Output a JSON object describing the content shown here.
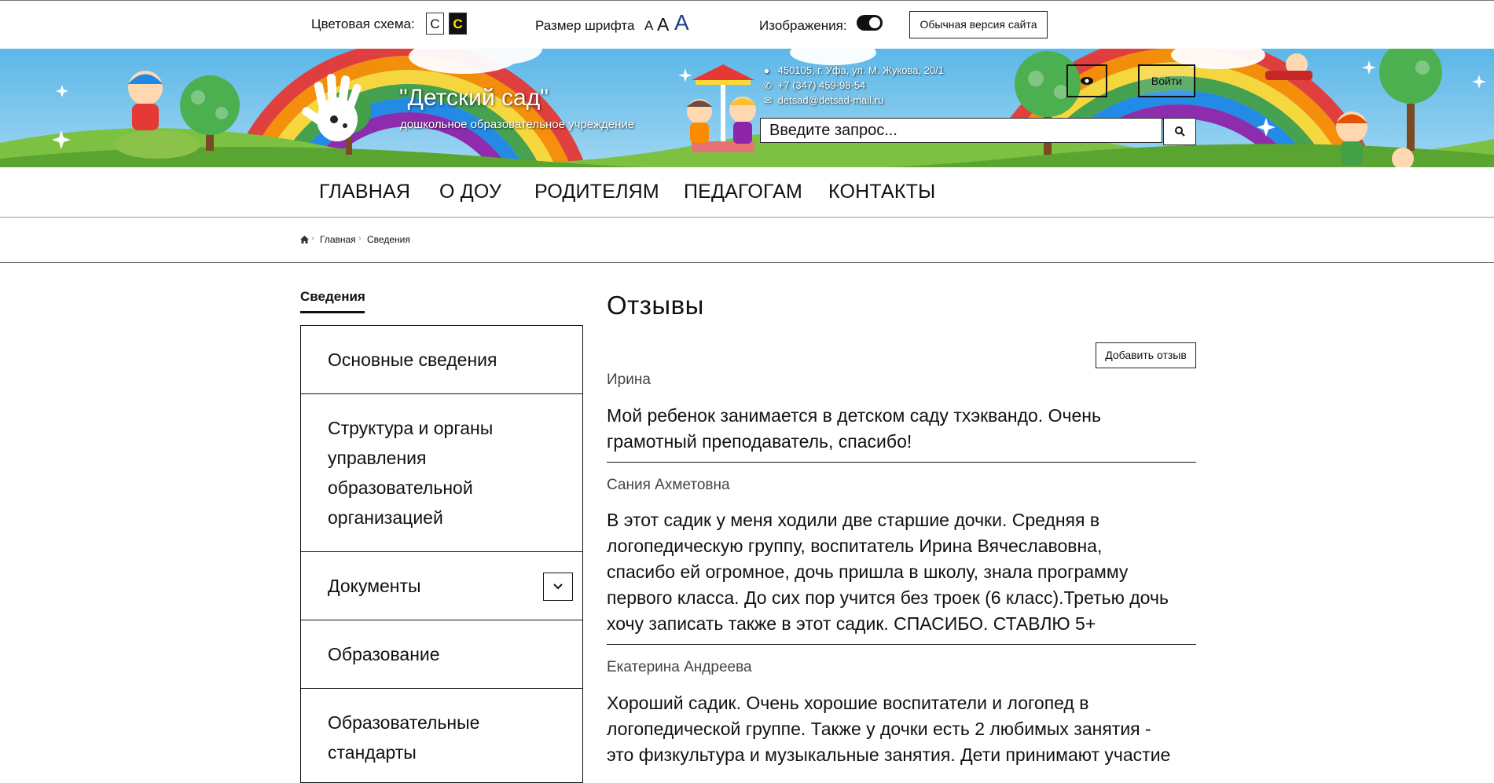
{
  "a11y": {
    "scheme_label": "Цветовая схема:",
    "scheme_light": "С",
    "scheme_dark": "С",
    "font_label": "Размер шрифта",
    "font_small": "А",
    "font_medium": "А",
    "font_large": "А",
    "images_label": "Изображения:",
    "normal_version": "Обычная версия сайта"
  },
  "header": {
    "title": "\"Детский сад\"",
    "subtitle": "дошкольное образовательное учреждение",
    "address": "450105, г. Уфа, ул. М. Жукова, 20/1",
    "phone": "+7 (347) 459-98-54",
    "email": "detsad@detsad-mail.ru",
    "login": "Войти",
    "search_placeholder": "Введите запрос..."
  },
  "nav": {
    "items": [
      {
        "label": "ГЛАВНАЯ"
      },
      {
        "label": "О ДОУ"
      },
      {
        "label": "РОДИТЕЛЯМ"
      },
      {
        "label": "ПЕДАГОГАМ"
      },
      {
        "label": "КОНТАКТЫ"
      }
    ]
  },
  "breadcrumb": {
    "home": "Главная",
    "current": "Сведения"
  },
  "sidebar": {
    "title": "Сведения",
    "items": [
      {
        "label": "Основные сведения"
      },
      {
        "label": "Структура и органы управления образовательной организацией"
      },
      {
        "label": "Документы"
      },
      {
        "label": "Образование"
      },
      {
        "label": "Образовательные стандарты"
      }
    ]
  },
  "main": {
    "title": "Отзывы",
    "add_review": "Добавить отзыв",
    "reviews": [
      {
        "author": "Ирина",
        "lines": [
          "Мой ребенок занимается в детском саду тхэквандо. Очень",
          "грамотный преподаватель, спасибо!"
        ]
      },
      {
        "author": "Сания Ахметовна",
        "lines": [
          "В этот садик у меня ходили две старшие дочки. Средняя в",
          "логопедическую группу, воспитатель Ирина Вячеславовна,",
          "спасибо ей огромное, дочь пришла в школу, знала программу",
          "первого класса. До сих пор учится без троек (6 класс).Третью дочь",
          "хочу записать также в этот садик. СПАСИБО. СТАВЛЮ 5+"
        ]
      },
      {
        "author": "Екатерина Андреева",
        "lines": [
          "Хороший садик. Очень хорошие воспитатели и логопед в",
          "логопедической группе. Также у дочки есть 2 любимых занятия -",
          "это физкультура и музыкальные занятия. Дети принимают участие"
        ]
      }
    ]
  }
}
